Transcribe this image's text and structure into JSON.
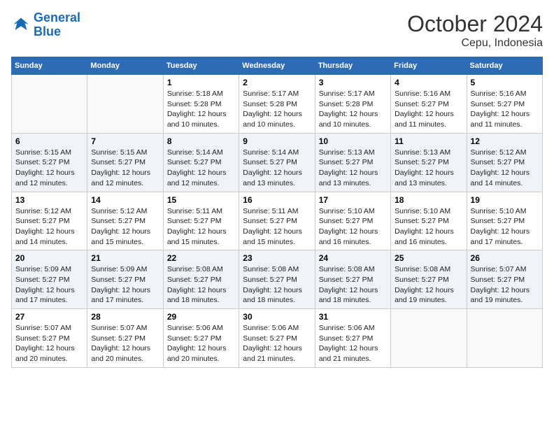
{
  "logo": {
    "line1": "General",
    "line2": "Blue"
  },
  "title": "October 2024",
  "subtitle": "Cepu, Indonesia",
  "weekdays": [
    "Sunday",
    "Monday",
    "Tuesday",
    "Wednesday",
    "Thursday",
    "Friday",
    "Saturday"
  ],
  "weeks": [
    [
      {
        "day": "",
        "info": ""
      },
      {
        "day": "",
        "info": ""
      },
      {
        "day": "1",
        "info": "Sunrise: 5:18 AM\nSunset: 5:28 PM\nDaylight: 12 hours and 10 minutes."
      },
      {
        "day": "2",
        "info": "Sunrise: 5:17 AM\nSunset: 5:28 PM\nDaylight: 12 hours and 10 minutes."
      },
      {
        "day": "3",
        "info": "Sunrise: 5:17 AM\nSunset: 5:28 PM\nDaylight: 12 hours and 10 minutes."
      },
      {
        "day": "4",
        "info": "Sunrise: 5:16 AM\nSunset: 5:27 PM\nDaylight: 12 hours and 11 minutes."
      },
      {
        "day": "5",
        "info": "Sunrise: 5:16 AM\nSunset: 5:27 PM\nDaylight: 12 hours and 11 minutes."
      }
    ],
    [
      {
        "day": "6",
        "info": "Sunrise: 5:15 AM\nSunset: 5:27 PM\nDaylight: 12 hours and 12 minutes."
      },
      {
        "day": "7",
        "info": "Sunrise: 5:15 AM\nSunset: 5:27 PM\nDaylight: 12 hours and 12 minutes."
      },
      {
        "day": "8",
        "info": "Sunrise: 5:14 AM\nSunset: 5:27 PM\nDaylight: 12 hours and 12 minutes."
      },
      {
        "day": "9",
        "info": "Sunrise: 5:14 AM\nSunset: 5:27 PM\nDaylight: 12 hours and 13 minutes."
      },
      {
        "day": "10",
        "info": "Sunrise: 5:13 AM\nSunset: 5:27 PM\nDaylight: 12 hours and 13 minutes."
      },
      {
        "day": "11",
        "info": "Sunrise: 5:13 AM\nSunset: 5:27 PM\nDaylight: 12 hours and 13 minutes."
      },
      {
        "day": "12",
        "info": "Sunrise: 5:12 AM\nSunset: 5:27 PM\nDaylight: 12 hours and 14 minutes."
      }
    ],
    [
      {
        "day": "13",
        "info": "Sunrise: 5:12 AM\nSunset: 5:27 PM\nDaylight: 12 hours and 14 minutes."
      },
      {
        "day": "14",
        "info": "Sunrise: 5:12 AM\nSunset: 5:27 PM\nDaylight: 12 hours and 15 minutes."
      },
      {
        "day": "15",
        "info": "Sunrise: 5:11 AM\nSunset: 5:27 PM\nDaylight: 12 hours and 15 minutes."
      },
      {
        "day": "16",
        "info": "Sunrise: 5:11 AM\nSunset: 5:27 PM\nDaylight: 12 hours and 15 minutes."
      },
      {
        "day": "17",
        "info": "Sunrise: 5:10 AM\nSunset: 5:27 PM\nDaylight: 12 hours and 16 minutes."
      },
      {
        "day": "18",
        "info": "Sunrise: 5:10 AM\nSunset: 5:27 PM\nDaylight: 12 hours and 16 minutes."
      },
      {
        "day": "19",
        "info": "Sunrise: 5:10 AM\nSunset: 5:27 PM\nDaylight: 12 hours and 17 minutes."
      }
    ],
    [
      {
        "day": "20",
        "info": "Sunrise: 5:09 AM\nSunset: 5:27 PM\nDaylight: 12 hours and 17 minutes."
      },
      {
        "day": "21",
        "info": "Sunrise: 5:09 AM\nSunset: 5:27 PM\nDaylight: 12 hours and 17 minutes."
      },
      {
        "day": "22",
        "info": "Sunrise: 5:08 AM\nSunset: 5:27 PM\nDaylight: 12 hours and 18 minutes."
      },
      {
        "day": "23",
        "info": "Sunrise: 5:08 AM\nSunset: 5:27 PM\nDaylight: 12 hours and 18 minutes."
      },
      {
        "day": "24",
        "info": "Sunrise: 5:08 AM\nSunset: 5:27 PM\nDaylight: 12 hours and 18 minutes."
      },
      {
        "day": "25",
        "info": "Sunrise: 5:08 AM\nSunset: 5:27 PM\nDaylight: 12 hours and 19 minutes."
      },
      {
        "day": "26",
        "info": "Sunrise: 5:07 AM\nSunset: 5:27 PM\nDaylight: 12 hours and 19 minutes."
      }
    ],
    [
      {
        "day": "27",
        "info": "Sunrise: 5:07 AM\nSunset: 5:27 PM\nDaylight: 12 hours and 20 minutes."
      },
      {
        "day": "28",
        "info": "Sunrise: 5:07 AM\nSunset: 5:27 PM\nDaylight: 12 hours and 20 minutes."
      },
      {
        "day": "29",
        "info": "Sunrise: 5:06 AM\nSunset: 5:27 PM\nDaylight: 12 hours and 20 minutes."
      },
      {
        "day": "30",
        "info": "Sunrise: 5:06 AM\nSunset: 5:27 PM\nDaylight: 12 hours and 21 minutes."
      },
      {
        "day": "31",
        "info": "Sunrise: 5:06 AM\nSunset: 5:27 PM\nDaylight: 12 hours and 21 minutes."
      },
      {
        "day": "",
        "info": ""
      },
      {
        "day": "",
        "info": ""
      }
    ]
  ]
}
